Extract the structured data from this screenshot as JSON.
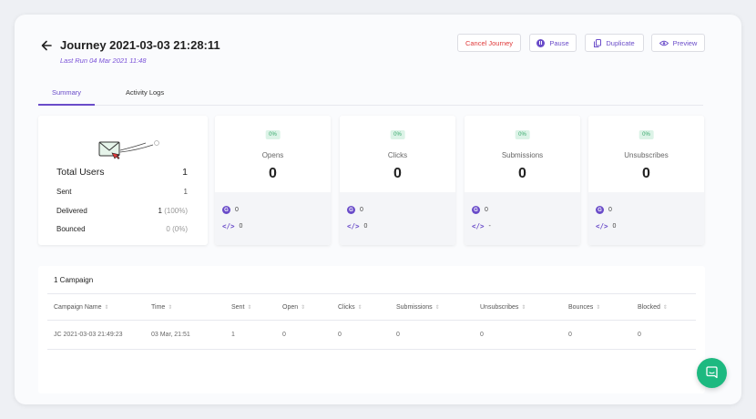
{
  "header": {
    "title": "Journey 2021-03-03 21:28:11",
    "last_run": "Last Run 04 Mar 2021 11:48",
    "buttons": {
      "cancel": "Cancel Journey",
      "pause": "Pause",
      "duplicate": "Duplicate",
      "preview": "Preview"
    }
  },
  "tabs": [
    {
      "label": "Summary",
      "active": true
    },
    {
      "label": "Activity Logs",
      "active": false
    }
  ],
  "users": {
    "total_label": "Total Users",
    "total_value": "1",
    "rows": [
      {
        "label": "Sent",
        "value": "1"
      },
      {
        "label": "Delivered",
        "value": "1",
        "extra": "(100%)"
      },
      {
        "label": "Bounced",
        "value": "0",
        "extra": "(0%)"
      }
    ]
  },
  "metrics": [
    {
      "label": "Opens",
      "percent": "0%",
      "value": "0",
      "google": "0",
      "code": "0"
    },
    {
      "label": "Clicks",
      "percent": "0%",
      "value": "0",
      "google": "0",
      "code": "0"
    },
    {
      "label": "Submissions",
      "percent": "0%",
      "value": "0",
      "google": "0",
      "code": "-"
    },
    {
      "label": "Unsubscribes",
      "percent": "0%",
      "value": "0",
      "google": "0",
      "code": "0"
    }
  ],
  "campaigns": {
    "title": "1 Campaign",
    "columns": [
      "Campaign Name",
      "Time",
      "Sent",
      "Open",
      "Clicks",
      "Submissions",
      "Unsubscribes",
      "Bounces",
      "Blocked"
    ],
    "rows": [
      [
        "JC 2021-03-03 21:49:23",
        "03 Mar, 21:51",
        "1",
        "0",
        "0",
        "0",
        "0",
        "0",
        "0"
      ]
    ]
  },
  "colors": {
    "accent": "#6a4cc9",
    "danger": "#e03a3a",
    "success_badge": "#dcf3e7",
    "chat": "#1db980"
  },
  "icons": {
    "back": "arrow-left-icon",
    "pause": "pause-circle-icon",
    "duplicate": "copy-icon",
    "preview": "eye-icon",
    "chat": "chat-bubble-icon",
    "envelope": "envelope-illustration"
  }
}
